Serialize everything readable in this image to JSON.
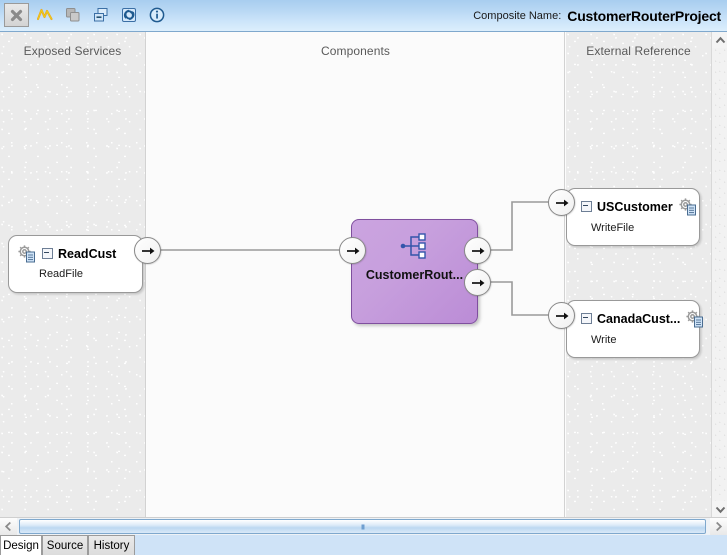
{
  "header": {
    "composite_label": "Composite Name:",
    "composite_name": "CustomerRouterProject",
    "toolbar": [
      {
        "name": "close-icon",
        "tooltip": "Close"
      },
      {
        "name": "trend-icon",
        "tooltip": "Trend"
      },
      {
        "name": "copy-icon",
        "tooltip": "Copy"
      },
      {
        "name": "collapse-icon",
        "tooltip": "Collapse"
      },
      {
        "name": "refresh-icon",
        "tooltip": "Refresh"
      },
      {
        "name": "info-icon",
        "tooltip": "Info"
      }
    ]
  },
  "lanes": {
    "exposed_services": "Exposed Services",
    "components": "Components",
    "external_reference": "External Reference"
  },
  "exposed_services": [
    {
      "title": "ReadCust",
      "subtitle": "ReadFile",
      "icon": "service-gear-icon",
      "expander": "collapse-box"
    }
  ],
  "components": [
    {
      "title": "CustomerRout...",
      "icon": "router-branch-icon",
      "type": "mediator",
      "color": "#c49fdd",
      "inputs": 1,
      "outputs": 2
    }
  ],
  "external_references": [
    {
      "title": "USCustomer",
      "subtitle": "WriteFile",
      "icon": "service-gear-icon",
      "expander": "collapse-box"
    },
    {
      "title": "CanadaCust...",
      "subtitle": "Write",
      "icon": "service-gear-icon",
      "expander": "collapse-box"
    }
  ],
  "tabs": [
    {
      "label": "Design",
      "active": true
    },
    {
      "label": "Source",
      "active": false
    },
    {
      "label": "History",
      "active": false
    }
  ],
  "scrollbars": {
    "vertical": {
      "up": "scroll-up-arrow",
      "down": "scroll-down-arrow"
    },
    "horizontal": {
      "left": "scroll-left-arrow",
      "right": "scroll-right-arrow"
    }
  }
}
